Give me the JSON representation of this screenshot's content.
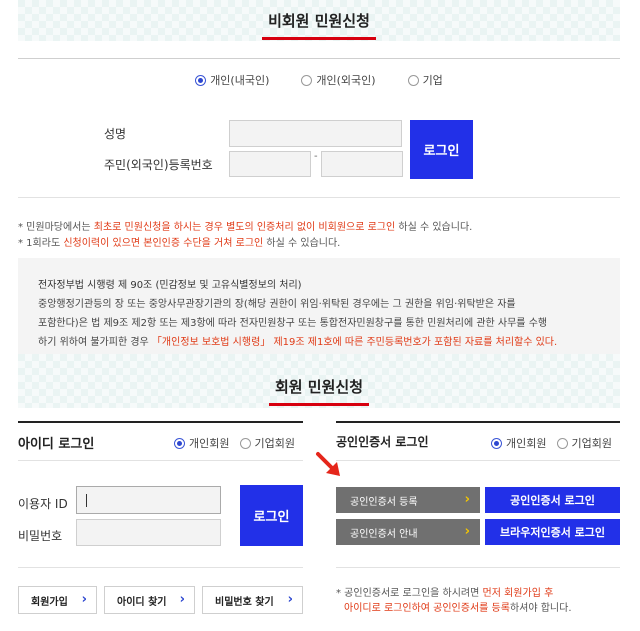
{
  "nonmember": {
    "title": "비회원 민원신청",
    "types": [
      "개인(내국인)",
      "개인(외국인)",
      "기업"
    ],
    "selected_type": "개인(내국인)",
    "name_label": "성명",
    "reg_label": "주민(외국인)등록번호",
    "reg_separator": "-",
    "login_button": "로그인"
  },
  "notes": {
    "line1_prefix": "* 민원마당에서는 ",
    "line1_red": "최초로 민원신청을 하시는 경우 별도의 인증처리 없이 비회원으로 로그인",
    "line1_suffix": " 하실 수 있습니다.",
    "line2_prefix": "* 1회라도 ",
    "line2_red": "신청이력이 있으면 본인인증 수단을 거쳐 로그인",
    "line2_suffix": " 하실 수 있습니다."
  },
  "privacy": {
    "heading": "전자정부법 시행령 제 90조 (민감정보 및 고유식별정보의 처리)",
    "line1": "중앙행정기관등의 장 또는 중앙사무관장기관의 장(해당 권한이 위임·위탁된 경우에는 그 권한을 위임·위탁받은 자를",
    "line2": "포함한다)은 법 제9조 제2항 또는 제3항에 따라 전자민원창구 또는 통합전자민원창구를 통한 민원처리에 관한 사무를 수행",
    "line3_prefix": "하기 위하여 불가피한 경우 ",
    "line3_red": "「개인정보 보호법 시행령」 제19조 제1호에 따른 주민등록번호가 포함된 자료를 처리할수 있다."
  },
  "member": {
    "title": "회원 민원신청",
    "id_login": {
      "title": "아이디 로그인",
      "types": [
        "개인회원",
        "기업회원"
      ],
      "selected_type": "개인회원",
      "user_id_label": "이용자 ID",
      "password_label": "비밀번호",
      "login_button": "로그인"
    },
    "cert_login": {
      "title": "공인인증서 로그인",
      "types": [
        "개인회원",
        "기업회원"
      ],
      "selected_type": "개인회원",
      "register_button": "공인인증서 등록",
      "guide_button": "공인인증서 안내",
      "cert_login_button": "공인인증서 로그인",
      "browser_login_button": "브라우저인증서 로그인",
      "note_prefix": "* 공인인증서로 로그인을 하시려면 ",
      "note_red": "먼저 회원가입 후",
      "note_red2": "아이디로 로그인하여 공인인증서를 등록",
      "note_suffix": "하셔야 합니다."
    },
    "links": {
      "signup": "회원가입",
      "find_id": "아이디 찾기",
      "find_password": "비밀번호 찾기"
    }
  },
  "icons": {
    "chevron": "›",
    "arrow_color": "#e5261b"
  }
}
